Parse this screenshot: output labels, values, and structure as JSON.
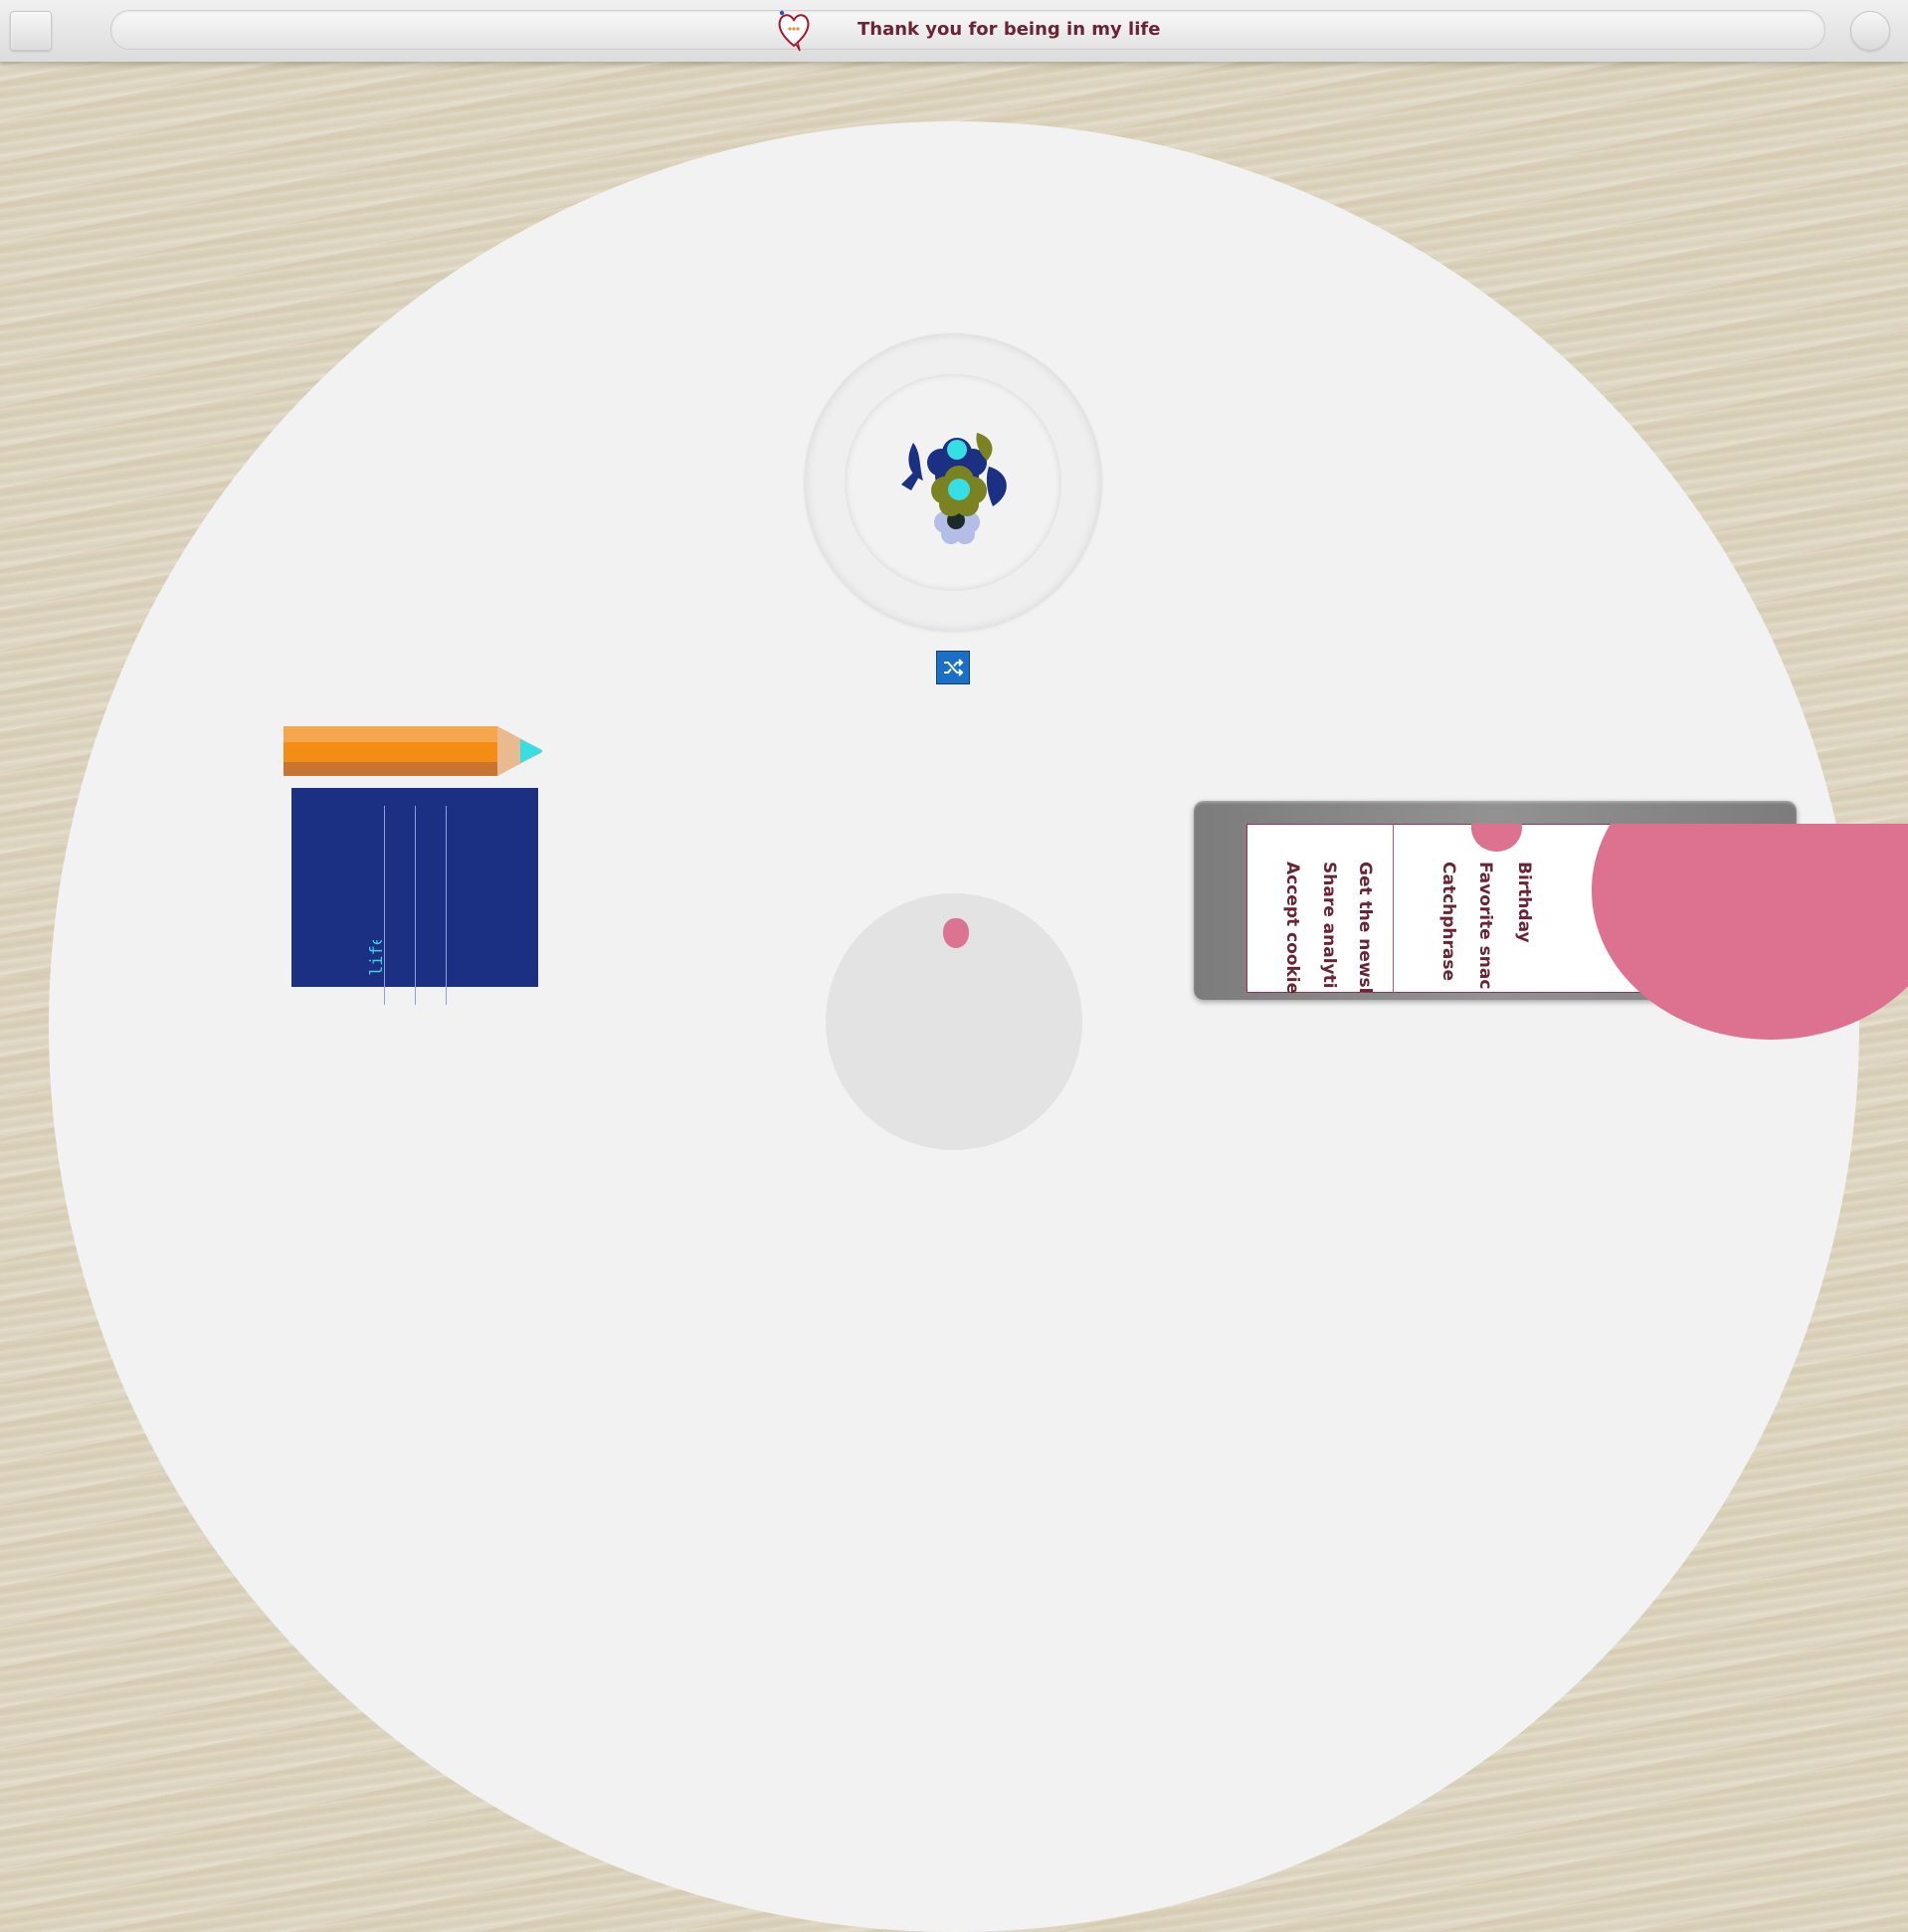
{
  "header": {
    "title": "Thank you for being in my life",
    "menu_icon": "menu-icon",
    "logo_icon": "heart-speech-logo-icon",
    "profile_icon": "round-button-icon"
  },
  "scene": {
    "shuffle_icon": "shuffle-icon",
    "notebook_text": "life",
    "bouquet_icon": "flower-bouquet-icon"
  },
  "tablet_form": {
    "labels": [
      "Birthday",
      "Favorite snac",
      "Catchphrase",
      "Get the newsl",
      "Share analyti",
      "Accept cookie"
    ]
  },
  "colors": {
    "title": "#6b2336",
    "accent_pink": "#dd7190",
    "notebook": "#1b2f83",
    "shuffle": "#1a6fc7"
  }
}
